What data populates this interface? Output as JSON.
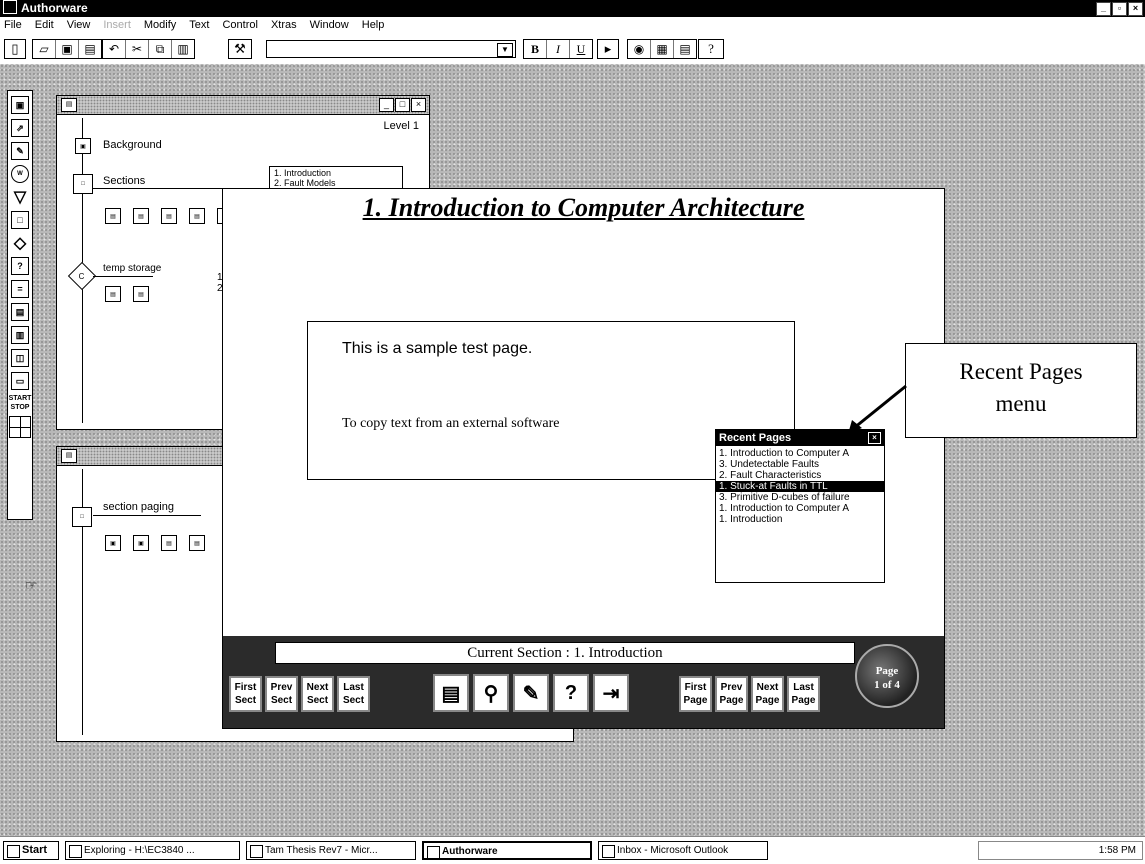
{
  "app": {
    "title": "Authorware"
  },
  "menu": [
    "File",
    "Edit",
    "View",
    "Insert",
    "Modify",
    "Text",
    "Control",
    "Xtras",
    "Window",
    "Help"
  ],
  "toolbar": {
    "bold": "B",
    "italic": "I",
    "underline": "U",
    "help": "?"
  },
  "palette": {
    "start": "START",
    "stop": "STOP"
  },
  "design1": {
    "level": "Level 1",
    "nodes": {
      "background": "Background",
      "sections": "Sections",
      "temp": "temp storage"
    },
    "list": [
      "1.   Introduction",
      "2.   Fault Models"
    ],
    "side_numbers": [
      "1",
      "2"
    ]
  },
  "design2": {
    "nodes": {
      "paging": "section paging"
    }
  },
  "presentation": {
    "title": "1.  Introduction to Computer Architecture",
    "sample_line1": "This is a sample test page.",
    "sample_line2": "To copy text from an external software",
    "current_section": "Current Section : 1.   Introduction",
    "nav_left": [
      [
        "First",
        "Sect"
      ],
      [
        "Prev",
        "Sect"
      ],
      [
        "Next",
        "Sect"
      ],
      [
        "Last",
        "Sect"
      ]
    ],
    "nav_right": [
      [
        "First",
        "Page"
      ],
      [
        "Prev",
        "Page"
      ],
      [
        "Next",
        "Page"
      ],
      [
        "Last",
        "Page"
      ]
    ],
    "page_badge": {
      "line1": "Page",
      "line2": "1 of 4"
    }
  },
  "recent_pages": {
    "title": "Recent Pages",
    "items": [
      "1.  Introduction to Computer A",
      "3.  Undetectable Faults",
      "2.  Fault Characteristics",
      "1.  Stuck-at Faults in TTL",
      "3.  Primitive D-cubes of failure",
      "1.  Introduction to Computer A",
      "1.   Introduction"
    ],
    "selected_index": 3
  },
  "callout": {
    "line1": "Recent Pages",
    "line2": "menu"
  },
  "taskbar": {
    "start": "Start",
    "tasks": [
      "Exploring - H:\\EC3840 ...",
      "Tam Thesis Rev7 - Micr...",
      "Authorware",
      "Inbox - Microsoft Outlook"
    ],
    "clock": "1:58 PM"
  }
}
